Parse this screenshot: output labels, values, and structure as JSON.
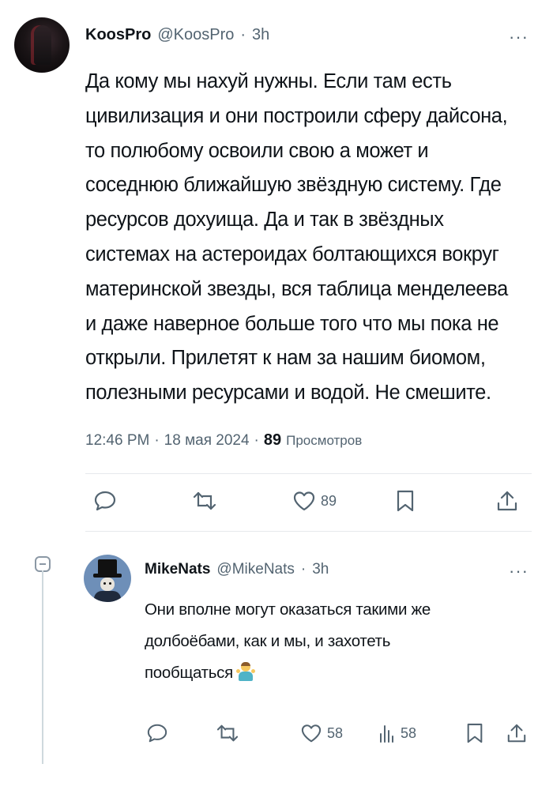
{
  "tweet": {
    "author_name": "KoosPro",
    "author_handle": "@KoosPro",
    "dot": "·",
    "time": "3h",
    "more": "···",
    "text": "Да кому мы нахуй нужны. Если там есть\nцивилизация и они построили сферу дайсона,\nто полюбому освоили свою а может и\nсоседнюю ближайшую звёздную систему. Где\nресурсов дохуища. Да и так в звёздных\nсистемах на астероидах болтающихся вокруг\nматеринской звезды, вся таблица менделеева\nи даже наверное больше того что мы пока не\nоткрыли. Прилетят к нам за нашим биомом,\nполезными ресурсами и водой. Не смешите.",
    "timestamp": "12:46 PM",
    "date": "18 мая 2024",
    "views_count": "89",
    "views_label": "Просмотров",
    "likes": "89",
    "icons": [
      "reply-icon",
      "retweet-icon",
      "like-icon",
      "bookmark-icon",
      "share-icon"
    ]
  },
  "reply": {
    "author_name": "MikeNats",
    "author_handle": "@MikeNats",
    "dot": "·",
    "time": "3h",
    "more": "···",
    "text": "Они вполне могут оказаться такими же\nдолбоёбами, как и мы, и захотеть\nпообщаться",
    "emoji": "person-shrugging-emoji",
    "likes": "58",
    "views": "58",
    "icons": [
      "reply-icon",
      "retweet-icon",
      "like-icon",
      "views-icon",
      "bookmark-icon",
      "share-icon"
    ]
  },
  "colors": {
    "text": "#0f1419",
    "secondary": "#536471",
    "divider": "#e6e9ec",
    "thread_line": "#cfd9de"
  }
}
